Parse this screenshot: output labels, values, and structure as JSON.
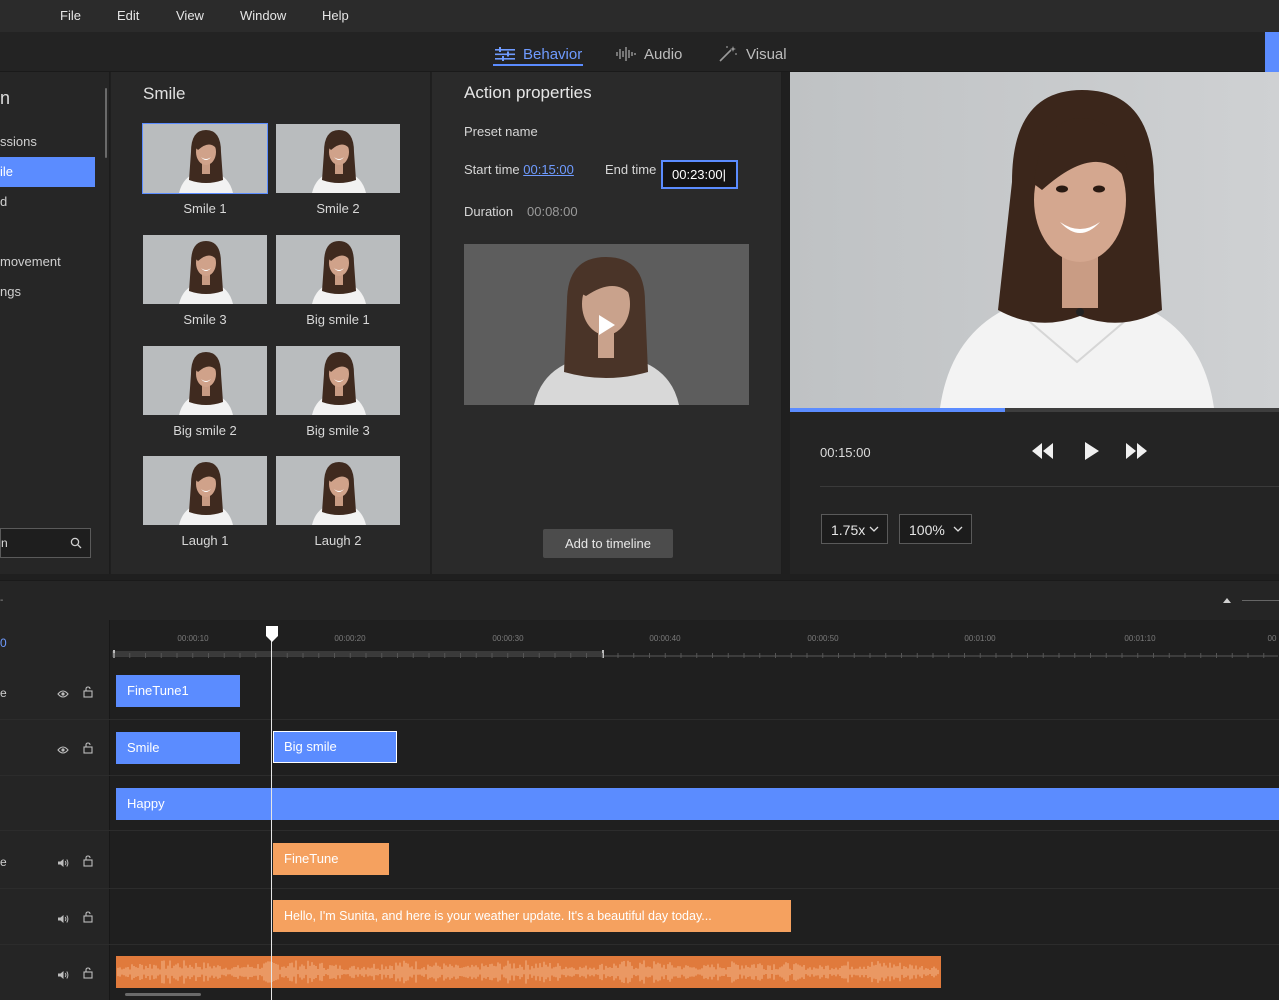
{
  "menu": {
    "file": "File",
    "edit": "Edit",
    "view": "View",
    "window": "Window",
    "help": "Help"
  },
  "tabs": {
    "behavior": "Behavior",
    "audio": "Audio",
    "visual": "Visual"
  },
  "sidebar": {
    "header": "n",
    "items": [
      "ssions",
      "ile",
      "d",
      "movement",
      "ngs"
    ],
    "search_value": "n"
  },
  "grid": {
    "title": "Smile",
    "items": [
      "Smile 1",
      "Smile 2",
      "Smile 3",
      "Big smile 1",
      "Big smile 2",
      "Big smile 3",
      "Laugh 1",
      "Laugh 2"
    ]
  },
  "properties": {
    "title": "Action properties",
    "preset_label": "Preset name",
    "start_label": "Start time",
    "start_value": "00:15:00",
    "end_label": "End time",
    "end_value": "00:23:00|",
    "duration_label": "Duration",
    "duration_value": "00:08:00",
    "add_button": "Add to timeline"
  },
  "player": {
    "time": "00:15:00",
    "progress": 0.44,
    "speed": "1.75x",
    "zoom": "100%"
  },
  "timeline": {
    "current_timecode": "0",
    "ticks": [
      "00:00:10",
      "00:00:20",
      "00:00:30",
      "00:00:40",
      "00:00:50",
      "00:01:00",
      "00:01:10",
      "00"
    ],
    "row_labels": [
      "e",
      "",
      "",
      "e",
      "",
      ""
    ],
    "clips": {
      "finetune1": "FineTune1",
      "smile": "Smile",
      "big_smile": "Big smile",
      "happy": "Happy",
      "finetune": "FineTune",
      "speech": "Hello, I'm Sunita, and here is your weather update.  It's a beautiful day today..."
    }
  },
  "colors": {
    "accent": "#5b8cff",
    "orange": "#f5a15f",
    "wave": "#e07a3c"
  }
}
